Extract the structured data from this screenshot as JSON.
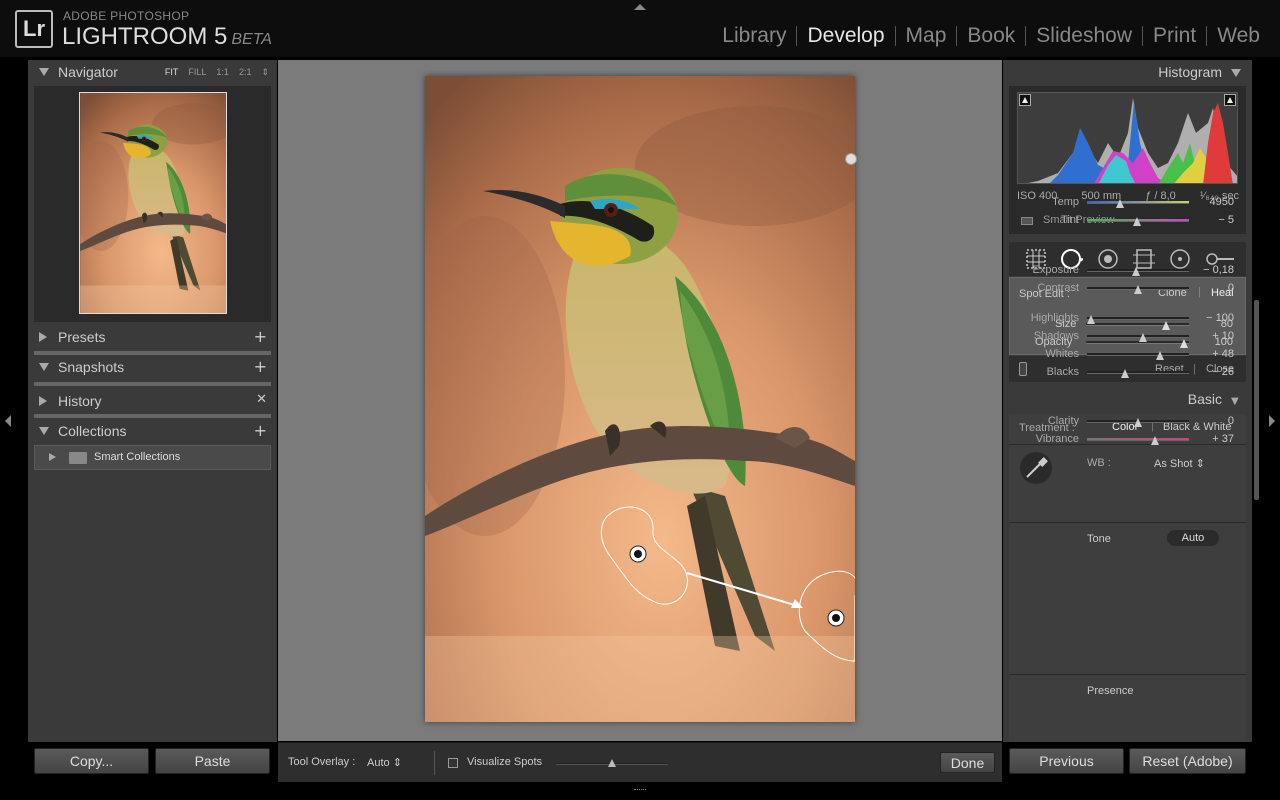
{
  "brand": {
    "top": "ADOBE PHOTOSHOP",
    "main": "LIGHTROOM 5",
    "beta": "BETA",
    "logo": "Lr"
  },
  "modules": [
    "Library",
    "Develop",
    "Map",
    "Book",
    "Slideshow",
    "Print",
    "Web"
  ],
  "active_module": "Develop",
  "left": {
    "navigator": {
      "title": "Navigator",
      "zoom": [
        "FIT",
        "FILL",
        "1:1",
        "2:1"
      ]
    },
    "presets": "Presets",
    "snapshots": "Snapshots",
    "history": "History",
    "collections": "Collections",
    "smart_collections": "Smart Collections",
    "copy": "Copy...",
    "paste": "Paste"
  },
  "toolbar": {
    "overlay_label": "Tool Overlay :",
    "overlay_value": "Auto",
    "visualize": "Visualize Spots",
    "visualize_level": 0.5,
    "done": "Done"
  },
  "right": {
    "histogram_title": "Histogram",
    "iso": "ISO 400",
    "focal": "500 mm",
    "aperture": "ƒ / 8,0",
    "shutter": "¹⁄₆₄₀ sec",
    "smart_preview": "Smart Preview",
    "spot": {
      "label": "Spot Edit :",
      "clone": "Clone",
      "heal": "Heal",
      "size_label": "Size",
      "size_value": "80",
      "opacity_label": "Opacity",
      "opacity_value": "100",
      "size_level": 0.78,
      "opacity_level": 0.95,
      "reset": "Reset",
      "close": "Close"
    },
    "basic_title": "Basic",
    "treatment_label": "Treatment :",
    "color": "Color",
    "bw": "Black & White",
    "wb_label": "WB :",
    "wb_value": "As Shot",
    "tone": "Tone",
    "auto": "Auto",
    "presence": "Presence",
    "sliders": [
      {
        "key": "temp",
        "label": "Temp",
        "value": "4950",
        "level": 0.32
      },
      {
        "key": "tint",
        "label": "Tint",
        "value": "− 5",
        "level": 0.49
      },
      {
        "key": "exposure",
        "label": "Exposure",
        "value": "− 0,18",
        "level": 0.48
      },
      {
        "key": "contrast",
        "label": "Contrast",
        "value": "0",
        "level": 0.5
      },
      {
        "key": "highlights",
        "label": "Highlights",
        "value": "− 100",
        "level": 0.04
      },
      {
        "key": "shadows",
        "label": "Shadows",
        "value": "+ 10",
        "level": 0.55
      },
      {
        "key": "whites",
        "label": "Whites",
        "value": "+ 48",
        "level": 0.72
      },
      {
        "key": "blacks",
        "label": "Blacks",
        "value": "− 26",
        "level": 0.37
      },
      {
        "key": "clarity",
        "label": "Clarity",
        "value": "0",
        "level": 0.5
      },
      {
        "key": "vibrance",
        "label": "Vibrance",
        "value": "+ 37",
        "level": 0.67
      }
    ],
    "previous": "Previous",
    "reset_adobe": "Reset (Adobe)"
  },
  "colors": {
    "accent": "#e6e6e6",
    "panel": "#3a3a3a",
    "canvas": "#7b7b7b"
  }
}
